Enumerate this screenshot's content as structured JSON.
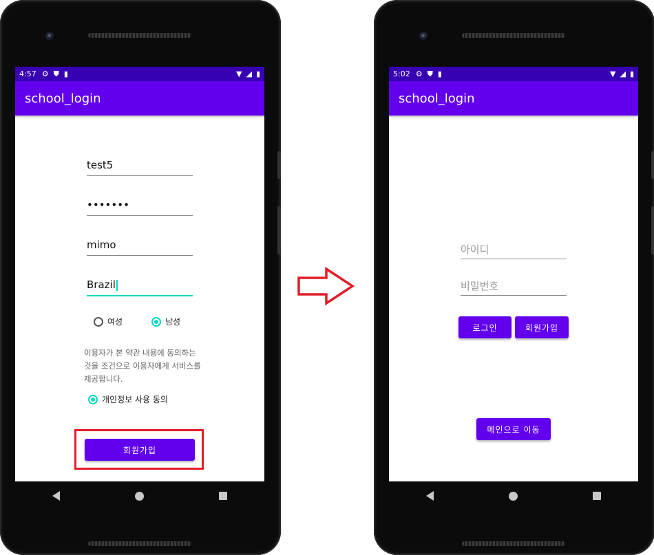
{
  "left_screen": {
    "status_time": "4:57",
    "app_title": "school_login",
    "fields": {
      "id_value": "test5",
      "password_value": "•••••••",
      "name_value": "mimo",
      "country_value": "Brazil"
    },
    "gender": {
      "female_label": "여성",
      "male_label": "남성",
      "selected": "남성"
    },
    "terms_text": "이용자가 본 약관 내용에 동의하는 것을 조건으로 이용자에게 서비스를 제공합니다.",
    "consent_label": "개인정보 사용 동의",
    "signup_button": "회원가입"
  },
  "right_screen": {
    "status_time": "5:02",
    "app_title": "school_login",
    "id_placeholder": "아이디",
    "password_placeholder": "비밀번호",
    "login_button": "로그인",
    "signup_button": "회원가입",
    "main_button": "메인으로 이동"
  },
  "icons": {
    "settings": "gear-icon",
    "shield": "shield-icon",
    "sim": "sim-card-icon",
    "wifi": "wifi-icon",
    "signal": "signal-icon",
    "battery": "battery-icon",
    "transition_arrow": "arrow-right-icon"
  },
  "colors": {
    "app_bar": "#6200ee",
    "status_bar": "#3700b3",
    "accent": "#03dac5",
    "highlight": "#e11d28"
  }
}
